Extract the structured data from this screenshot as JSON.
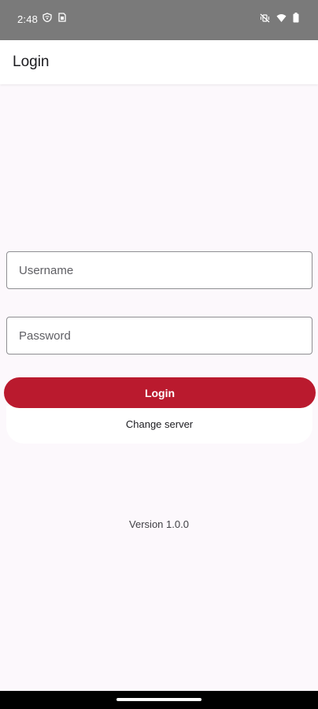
{
  "status_bar": {
    "time": "2:48",
    "left_icons": [
      "shield-wifi-icon",
      "sim-card-icon"
    ],
    "right_icons": [
      "vibrate-off-icon",
      "wifi-icon",
      "battery-icon"
    ]
  },
  "app_bar": {
    "title": "Login"
  },
  "form": {
    "username_placeholder": "Username",
    "password_placeholder": "Password",
    "login_label": "Login",
    "change_server_label": "Change server"
  },
  "footer": {
    "version": "Version 1.0.0"
  },
  "colors": {
    "primary": "#BA1A2E",
    "background": "#FCF8FC",
    "status_bar": "#7A7A7A"
  }
}
